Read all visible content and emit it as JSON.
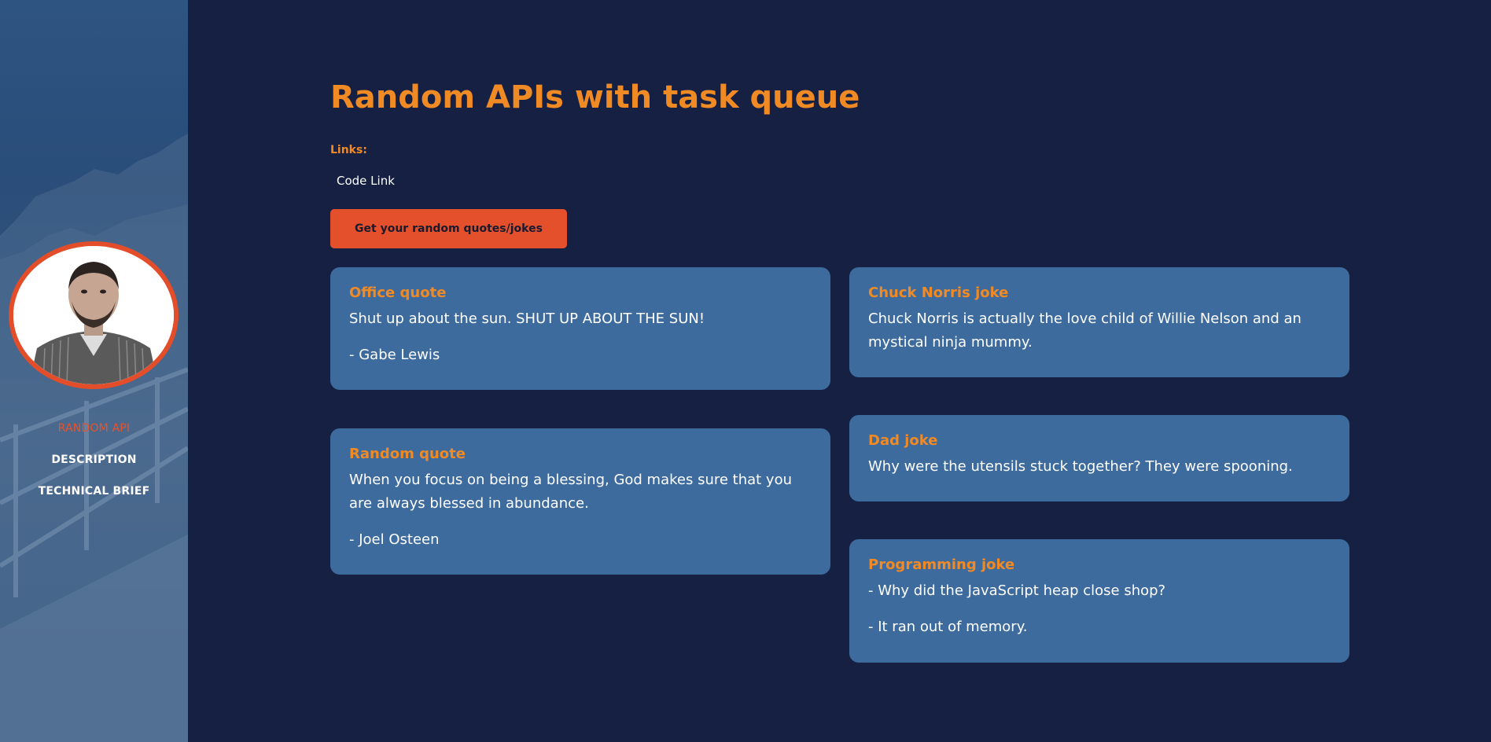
{
  "sidebar": {
    "nav": [
      {
        "label": "RANDOM API",
        "active": true
      },
      {
        "label": "DESCRIPTION",
        "active": false
      },
      {
        "label": "TECHNICAL BRIEF",
        "active": false
      }
    ]
  },
  "main": {
    "title": "Random APIs with task queue",
    "links_label": "Links:",
    "code_link": "Code Link",
    "cta_label": "Get your random quotes/jokes",
    "cards": {
      "office": {
        "title": "Office quote",
        "text": "Shut up about the sun. SHUT UP ABOUT THE SUN!",
        "author": "- Gabe Lewis"
      },
      "random": {
        "title": "Random quote",
        "text": "When you focus on being a blessing, God makes sure that you are always blessed in abundance.",
        "author": "- Joel Osteen"
      },
      "chuck": {
        "title": "Chuck Norris joke",
        "text": "Chuck Norris is actually the love child of Willie Nelson and an mystical ninja mummy."
      },
      "dad": {
        "title": "Dad joke",
        "text": "Why were the utensils stuck together? They were spooning."
      },
      "programming": {
        "title": "Programming joke",
        "setup": "- Why did the JavaScript heap close shop?",
        "punchline": "- It ran out of memory."
      }
    }
  },
  "colors": {
    "background": "#162043",
    "accent_orange": "#f08a24",
    "accent_red": "#e4502b",
    "card": "#3e6b9e"
  }
}
